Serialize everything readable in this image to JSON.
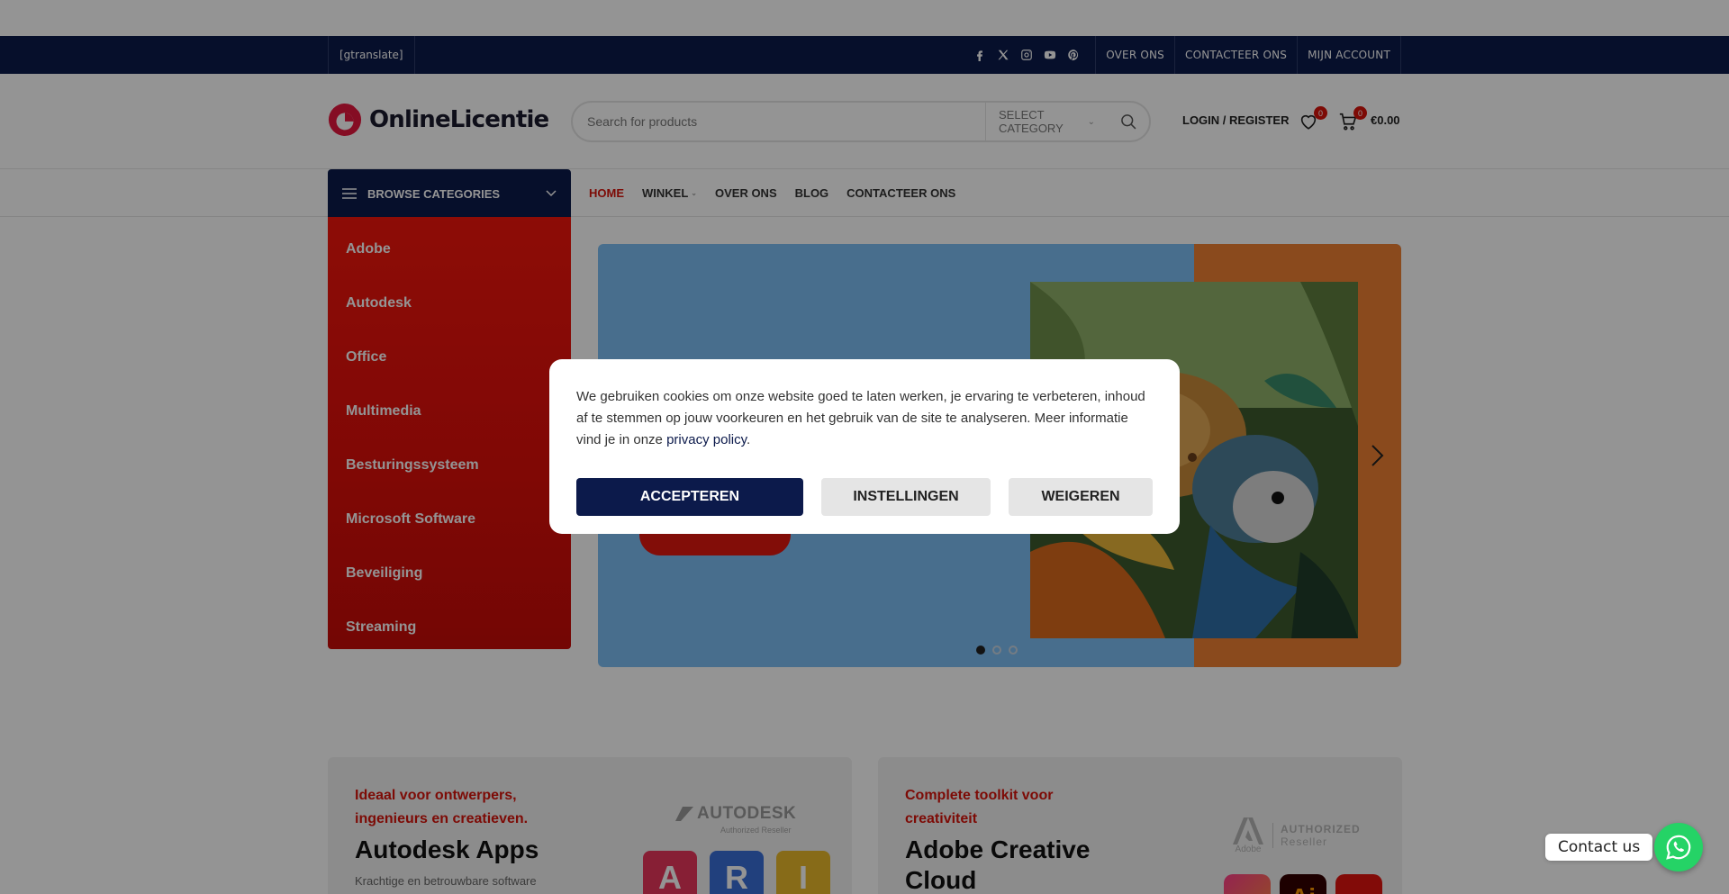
{
  "topbar": {
    "translate_label": "[gtranslate]",
    "social_icons": [
      "facebook-icon",
      "x-icon",
      "instagram-icon",
      "youtube-icon",
      "pinterest-icon"
    ],
    "links": [
      "OVER ONS",
      "CONTACTEER ONS",
      "MIJN ACCOUNT"
    ]
  },
  "header": {
    "logo_text": "OnlineLicentie",
    "search_placeholder": "Search for products",
    "category_select": "SELECT CATEGORY",
    "login_label": "LOGIN / REGISTER",
    "wishlist_count": "0",
    "cart_count": "0",
    "cart_total": "€0.00"
  },
  "nav": {
    "browse_label": "BROWSE CATEGORIES",
    "items": [
      {
        "label": "HOME",
        "active": true
      },
      {
        "label": "WINKEL",
        "dropdown": true
      },
      {
        "label": "OVER ONS"
      },
      {
        "label": "BLOG"
      },
      {
        "label": "CONTACTEER ONS"
      }
    ]
  },
  "sidebar": {
    "categories": [
      "Adobe",
      "Autodesk",
      "Office",
      "Multimedia",
      "Besturingssysteem",
      "Microsoft Software",
      "Beveiliging",
      "Streaming"
    ]
  },
  "slider": {
    "dots": 3,
    "active_dot": 0
  },
  "cards": [
    {
      "tag": "Ideaal voor ontwerpers, ingenieurs en creatieven.",
      "title": "Autodesk Apps",
      "subtitle": "Krachtige en betrouwbare software",
      "logo_line1": "AUTODESK",
      "logo_line2": "Authorized Reseller",
      "tiles": [
        "A",
        "R",
        "I"
      ]
    },
    {
      "tag": "Complete toolkit voor creativiteit",
      "title": "Adobe Creative Cloud",
      "logo_mark": "Adobe",
      "logo_line1": "AUTHORIZED",
      "logo_line2": "Reseller",
      "app_label": "Ai"
    }
  ],
  "cookie": {
    "text": "We gebruiken cookies om onze website goed te laten werken, je ervaring te verbeteren, inhoud af te stemmen op jouw voorkeuren en het gebruik van de site te analyseren. Meer informatie vind je in onze ",
    "link": "privacy policy",
    "trailing": ".",
    "accept": "ACCEPTEREN",
    "settings": "INSTELLINGEN",
    "decline": "WEIGEREN"
  },
  "contact": {
    "label": "Contact us"
  },
  "colors": {
    "navy": "#0c1a4b",
    "red": "#d7140c",
    "hero_blue": "#7cbef3",
    "hero_orange": "#ee8033",
    "whatsapp": "#25d366"
  }
}
